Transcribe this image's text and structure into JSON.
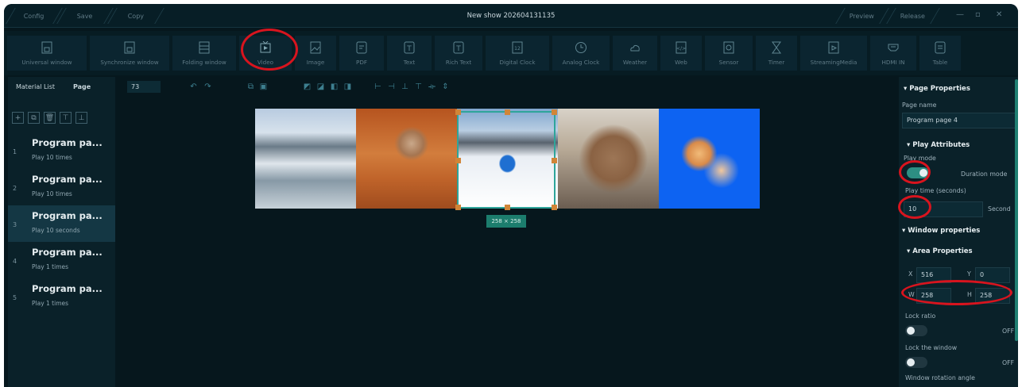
{
  "titlebar": {
    "title": "New show 202604131135",
    "left_buttons": [
      "Config",
      "Save",
      "Copy"
    ],
    "right_buttons": [
      "Preview",
      "Release"
    ],
    "win_controls": [
      "—",
      "▫",
      "✕"
    ]
  },
  "toolbar": {
    "tools": [
      {
        "label": "Universal window",
        "icon": "window-icon"
      },
      {
        "label": "Synchronize window",
        "icon": "window-icon"
      },
      {
        "label": "Folding window",
        "icon": "folding-icon"
      },
      {
        "label": "Video",
        "icon": "video-icon"
      },
      {
        "label": "Image",
        "icon": "image-icon"
      },
      {
        "label": "PDF",
        "icon": "pdf-icon"
      },
      {
        "label": "Text",
        "icon": "text-icon"
      },
      {
        "label": "Rich Text",
        "icon": "richtext-icon"
      },
      {
        "label": "Digital Clock",
        "icon": "digital-clock-icon"
      },
      {
        "label": "Analog Clock",
        "icon": "analog-clock-icon"
      },
      {
        "label": "Weather",
        "icon": "weather-icon"
      },
      {
        "label": "Web",
        "icon": "web-icon"
      },
      {
        "label": "Sensor",
        "icon": "sensor-icon"
      },
      {
        "label": "Timer",
        "icon": "timer-icon"
      },
      {
        "label": "StreamingMedia",
        "icon": "streaming-icon"
      },
      {
        "label": "HDMI IN",
        "icon": "hdmi-icon"
      },
      {
        "label": "Table",
        "icon": "table-icon"
      }
    ]
  },
  "left": {
    "tabs": [
      "Material List",
      "Page"
    ],
    "pages": [
      {
        "num": "1",
        "name": "Program pa...",
        "play": "Play 10 times"
      },
      {
        "num": "2",
        "name": "Program pa...",
        "play": "Play 10 times"
      },
      {
        "num": "3",
        "name": "Program pa...",
        "play": "Play 10 seconds"
      },
      {
        "num": "4",
        "name": "Program pa...",
        "play": "Play 1 times"
      },
      {
        "num": "5",
        "name": "Program pa...",
        "play": "Play 1 times"
      }
    ]
  },
  "canvas": {
    "zoom": "73",
    "size_label": "258 × 258"
  },
  "right": {
    "page_properties": "Page Properties",
    "page_name_label": "Page name",
    "page_name_value": "Program page 4",
    "play_attributes": "Play Attributes",
    "play_mode_label": "Play mode",
    "duration_mode": "Duration mode",
    "play_time_label": "Play time (seconds)",
    "play_time_value": "10",
    "second_unit": "Second",
    "window_properties": "Window properties",
    "area_properties": "Area Properties",
    "x_label": "X",
    "x_value": "516",
    "y_label": "Y",
    "y_value": "0",
    "w_label": "W",
    "w_value": "258",
    "h_label": "H",
    "h_value": "258",
    "lock_ratio": "Lock ratio",
    "lock_ratio_state": "OFF",
    "lock_window": "Lock the window",
    "lock_window_state": "OFF",
    "rotation": "Window rotation angle"
  },
  "colors": {
    "accent": "#2fa59a",
    "annotation": "#d8141e",
    "background": "#06171d"
  }
}
